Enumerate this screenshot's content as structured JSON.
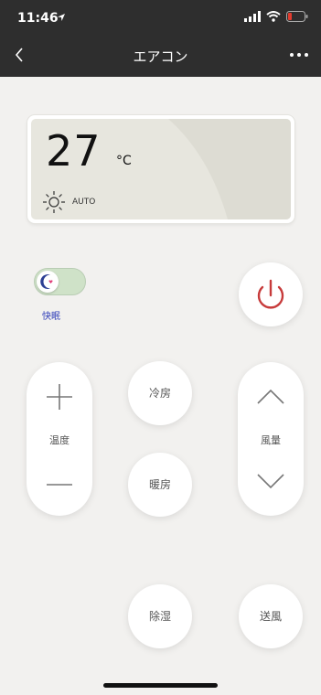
{
  "status_bar": {
    "time": "11:46"
  },
  "nav": {
    "title": "エアコン"
  },
  "display": {
    "temperature": "27",
    "unit": "°C",
    "mode": "AUTO"
  },
  "sleep": {
    "label": "快眠"
  },
  "controls": {
    "temperature_label": "温度",
    "cool_label": "冷房",
    "heat_label": "暖房",
    "fan_label": "風量",
    "dehumidify_label": "除湿",
    "fan_mode_label": "送風"
  },
  "colors": {
    "topbar": "#2e2e2e",
    "background": "#f2f1ef",
    "power_accent": "#c73b3b",
    "sleep_accent": "#2f3db8",
    "toggle_on": "#cfe2c8"
  }
}
